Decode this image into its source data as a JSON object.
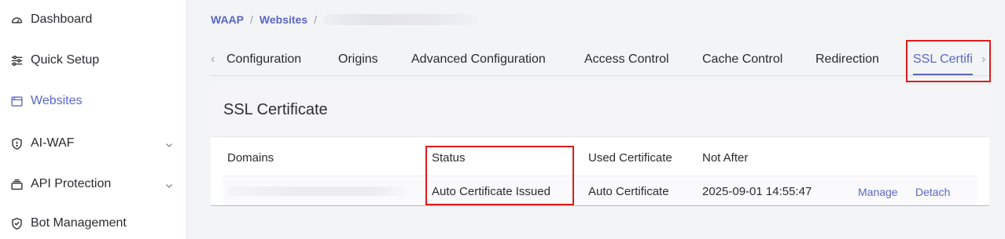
{
  "sidebar": {
    "items": [
      {
        "label": "Dashboard",
        "icon": "gauge-icon"
      },
      {
        "label": "Quick Setup",
        "icon": "sliders-icon"
      },
      {
        "label": "Websites",
        "icon": "browser-window-icon",
        "active": true
      },
      {
        "label": "AI-WAF",
        "icon": "shield-icon",
        "expandable": true
      },
      {
        "label": "API Protection",
        "icon": "api-stack-icon",
        "expandable": true
      },
      {
        "label": "Bot Management",
        "icon": "bot-shield-icon"
      }
    ]
  },
  "breadcrumb": {
    "items": [
      "WAAP",
      "Websites"
    ],
    "separator": "/"
  },
  "tabs": {
    "items": [
      "Configuration",
      "Origins",
      "Advanced Configuration",
      "Access Control",
      "Cache Control",
      "Redirection",
      "SSL Certifi"
    ],
    "active": "SSL Certifi",
    "prev_arrow": "‹",
    "next_arrow": "›"
  },
  "card": {
    "title": "SSL Certificate",
    "columns": [
      "Domains",
      "Status",
      "Used Certificate",
      "Not After"
    ],
    "rows": [
      {
        "status": "Auto Certificate Issued",
        "used_certificate": "Auto Certificate",
        "not_after": "2025-09-01 14:55:47",
        "actions": [
          "Manage",
          "Detach"
        ]
      }
    ]
  },
  "colors": {
    "accent": "#5a67c6",
    "highlight": "#e01b1b",
    "text": "#2b2b30"
  }
}
